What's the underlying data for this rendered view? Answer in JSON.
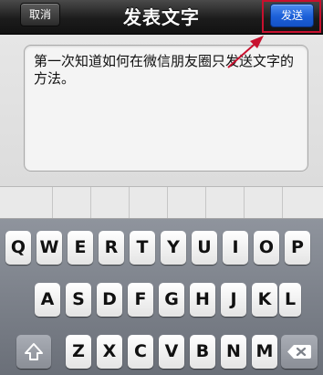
{
  "nav": {
    "title": "发表文字",
    "cancel_label": "取消",
    "send_label": "发送"
  },
  "compose": {
    "text": "第一次知道如何在微信朋友圈只发送文字的方法。"
  },
  "keyboard": {
    "row1": [
      "Q",
      "W",
      "E",
      "R",
      "T",
      "Y",
      "U",
      "I",
      "O",
      "P"
    ],
    "row2": [
      "A",
      "S",
      "D",
      "F",
      "G",
      "H",
      "J",
      "K",
      "L"
    ],
    "row3": [
      "Z",
      "X",
      "C",
      "V",
      "B",
      "N",
      "M"
    ],
    "shift_icon": "shift-arrow-icon",
    "backspace_icon": "backspace-icon"
  },
  "colors": {
    "send_button": "#1c5fd8",
    "highlight": "#c8102e"
  }
}
